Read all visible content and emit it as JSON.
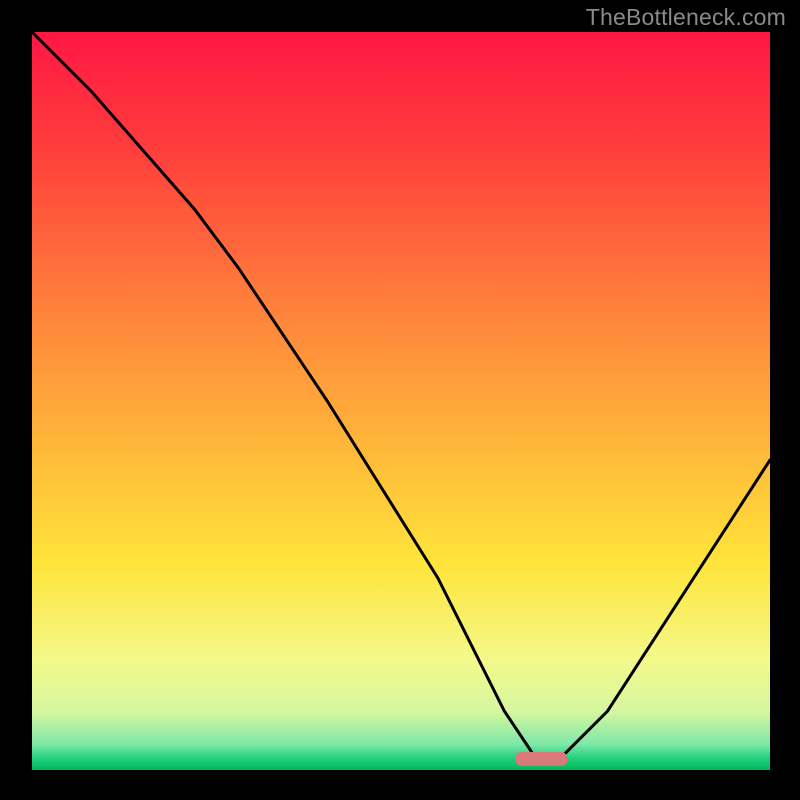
{
  "attribution": "TheBottleneck.com",
  "chart_data": {
    "type": "line",
    "title": "",
    "xlabel": "",
    "ylabel": "",
    "xlim": [
      0,
      100
    ],
    "ylim": [
      0,
      100
    ],
    "series": [
      {
        "name": "bottleneck-curve",
        "x": [
          0,
          8,
          22,
          28,
          40,
          55,
          64,
          68,
          72,
          78,
          100
        ],
        "values": [
          100,
          92,
          76,
          68,
          50,
          26,
          8,
          2,
          2,
          8,
          42
        ]
      }
    ],
    "marker": {
      "x_center": 69,
      "y": 1.5,
      "width": 7,
      "color": "#d97a7a"
    },
    "gradient_stops": [
      {
        "offset": 0,
        "color": "#ff1744"
      },
      {
        "offset": 0.15,
        "color": "#ff3b3b"
      },
      {
        "offset": 0.35,
        "color": "#ff7a3c"
      },
      {
        "offset": 0.55,
        "color": "#ffb43a"
      },
      {
        "offset": 0.72,
        "color": "#ffe43a"
      },
      {
        "offset": 0.85,
        "color": "#f4f98a"
      },
      {
        "offset": 0.92,
        "color": "#d6f7a0"
      },
      {
        "offset": 0.965,
        "color": "#7ee8a8"
      },
      {
        "offset": 0.985,
        "color": "#1fcf7a"
      },
      {
        "offset": 1.0,
        "color": "#00b85c"
      }
    ]
  }
}
